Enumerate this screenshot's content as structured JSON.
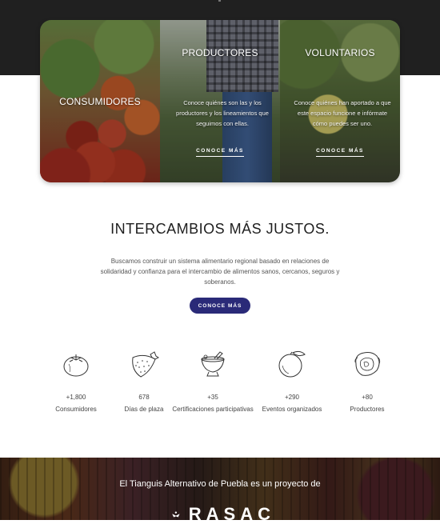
{
  "cards": [
    {
      "title": "CONSUMIDORES",
      "description": "",
      "link": ""
    },
    {
      "title": "PRODUCTORES",
      "description": "Conoce quiénes son las y los productores y los lineamientos que seguimos con ellas.",
      "link": "CONOCE MÁS"
    },
    {
      "title": "VOLUNTARIOS",
      "description": "Conoce quiénes han aportado a que este espacio funcione e infórmate cómo puedes ser uno.",
      "link": "CONOCE MÁS"
    }
  ],
  "intro": {
    "title": "INTERCAMBIOS MÁS JUSTOS.",
    "body": "Buscamos construir un sistema alimentario regional basado en relaciones de solidaridad y confianza para el intercambio de alimentos sanos, cercanos, seguros y soberanos.",
    "cta": "CONOCE MÁS"
  },
  "stats": [
    {
      "icon": "tomato-icon",
      "value": "+1,800",
      "label": "Consumidores"
    },
    {
      "icon": "strawberry-icon",
      "value": "678",
      "label": "Días de plaza"
    },
    {
      "icon": "mortar-icon",
      "value": "+35",
      "label": "Certificaciones participativas"
    },
    {
      "icon": "orange-icon",
      "value": "+290",
      "label": "Eventos organizados"
    },
    {
      "icon": "cabbage-icon",
      "value": "+80",
      "label": "Productores"
    }
  ],
  "footer": {
    "text": "El Tianguis Alternativo de Puebla es un proyecto de",
    "logo_text": "RASAC"
  },
  "colors": {
    "top_band": "#202020",
    "cta_background": "#2a2a78",
    "heading": "#1e1e1e"
  }
}
